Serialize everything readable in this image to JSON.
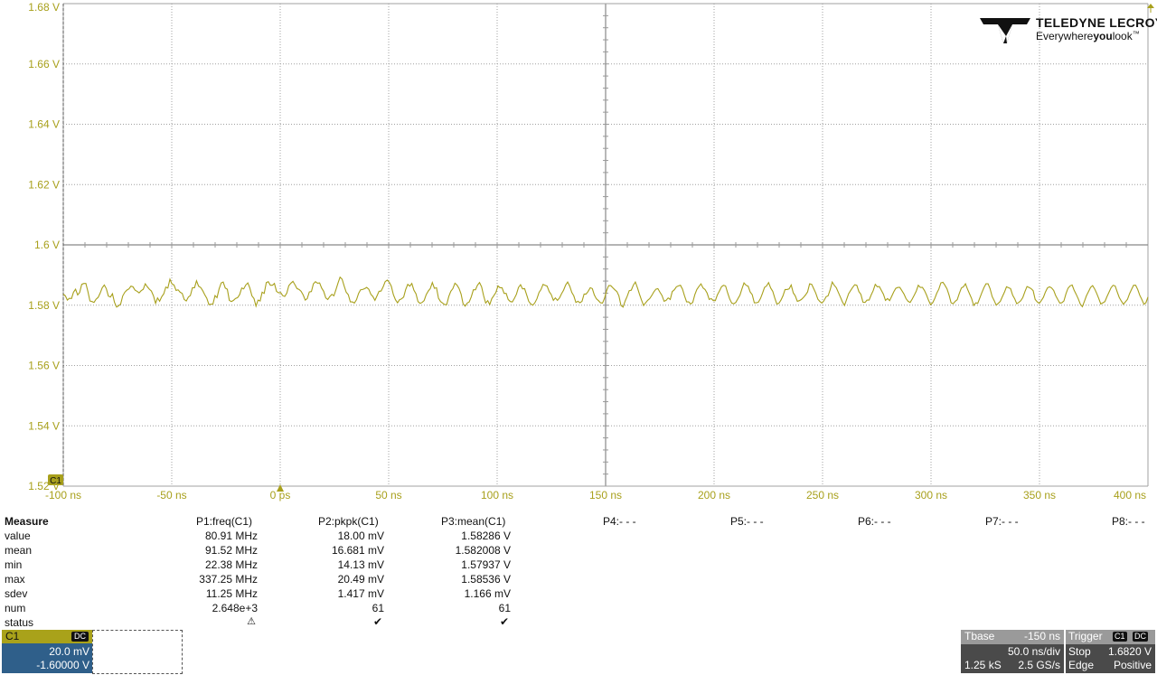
{
  "colors": {
    "channel": "#a8a01c",
    "grid": "#a0a0a0",
    "trace": "#a8a01c",
    "panel": "#4a4a4a",
    "channel_panel": "#2f5f8a"
  },
  "logo": {
    "brand": "TELEDYNE LECROY",
    "tag_pre": "Everywhere",
    "tag_bold": "you",
    "tag_post": "look",
    "trademark": "™"
  },
  "chart_data": {
    "type": "line",
    "y_tick_labels": [
      "1.68 V",
      "1.66 V",
      "1.64 V",
      "1.62 V",
      "1.6 V",
      "1.58 V",
      "1.56 V",
      "1.54 V",
      "1.52 V"
    ],
    "x_tick_labels": [
      "-100 ns",
      "-50 ns",
      "0 ps",
      "50 ns",
      "100 ns",
      "150 ns",
      "200 ns",
      "250 ns",
      "300 ns",
      "350 ns",
      "400 ns"
    ],
    "xlim_ns": [
      -100,
      400
    ],
    "ylim_V": [
      1.52,
      1.68
    ],
    "grid": true,
    "trigger_marker_ns": 0,
    "channel_marker": "C1",
    "series": [
      {
        "name": "C1",
        "approx_frequency_MHz": 80.91,
        "mean_V": 1.58286,
        "pkpk_mV": 18.0,
        "y": [
          1.5837,
          1.5831,
          1.5817,
          1.5823,
          1.5822,
          1.5843,
          1.5853,
          1.5834,
          1.5842,
          1.5869,
          1.5872,
          1.5872,
          1.5846,
          1.5814,
          1.5812,
          1.5809,
          1.582,
          1.5826,
          1.584,
          1.5858,
          1.5867,
          1.5855,
          1.583,
          1.5827,
          1.5838,
          1.5809,
          1.5794,
          1.5798,
          1.5804,
          1.5831,
          1.5843,
          1.585,
          1.5854,
          1.5863,
          1.5861,
          1.585,
          1.5846,
          1.5841,
          1.5848,
          1.5853,
          1.5871,
          1.5861,
          1.5853,
          1.5847,
          1.5831,
          1.5806,
          1.5824,
          1.5813,
          1.5828,
          1.5838,
          1.586,
          1.5857,
          1.5886,
          1.5871,
          1.5867,
          1.5849,
          1.5851,
          1.5843,
          1.5839,
          1.5819,
          1.5814,
          1.5827,
          1.5832,
          1.5858,
          1.5858,
          1.5881,
          1.5863,
          1.5859,
          1.5848,
          1.5835,
          1.5823,
          1.5802,
          1.5803,
          1.5804,
          1.5832,
          1.5825,
          1.5854,
          1.5874,
          1.5877,
          1.5857,
          1.5853,
          1.5816,
          1.5812,
          1.5816,
          1.5822,
          1.5825,
          1.5835,
          1.5857,
          1.5854,
          1.5867,
          1.5874,
          1.5857,
          1.5831,
          1.5822,
          1.5797,
          1.5817,
          1.5814,
          1.5843,
          1.5839,
          1.5875,
          1.5878,
          1.5866,
          1.5866,
          1.5872,
          1.5846,
          1.5841,
          1.5842,
          1.5832,
          1.5829,
          1.584,
          1.5865,
          1.5873,
          1.5879,
          1.5868,
          1.5855,
          1.5852,
          1.5846,
          1.5834,
          1.5817,
          1.5822,
          1.5844,
          1.5845,
          1.5871,
          1.5878,
          1.5873,
          1.5874,
          1.5857,
          1.5846,
          1.5824,
          1.5819,
          1.5829,
          1.5836,
          1.5831,
          1.5852,
          1.5874,
          1.5893,
          1.5886,
          1.5863,
          1.5843,
          1.5835,
          1.5811,
          1.5811,
          1.5807,
          1.5818,
          1.5839,
          1.5851,
          1.5852,
          1.5855,
          1.5859,
          1.5853,
          1.5836,
          1.5829,
          1.5816,
          1.5831,
          1.5846,
          1.5847,
          1.5861,
          1.5878,
          1.5883,
          1.5876,
          1.5863,
          1.5835,
          1.5818,
          1.5808,
          1.5818,
          1.5821,
          1.5827,
          1.5852,
          1.5869,
          1.5863,
          1.5872,
          1.585,
          1.5838,
          1.5812,
          1.5806,
          1.5809,
          1.5815,
          1.5835,
          1.5847,
          1.5855,
          1.5875,
          1.5856,
          1.5858,
          1.5823,
          1.5812,
          1.5807,
          1.5802,
          1.5802,
          1.5829,
          1.5846,
          1.5855,
          1.5873,
          1.5867,
          1.5856,
          1.5837,
          1.5805,
          1.5797,
          1.5807,
          1.5811,
          1.5828,
          1.5851,
          1.5851,
          1.5866,
          1.5875,
          1.5861,
          1.5832,
          1.5807,
          1.5815,
          1.5802,
          1.5822,
          1.5832,
          1.5842,
          1.5864,
          1.5858,
          1.5858,
          1.5839,
          1.5839,
          1.5819,
          1.5812,
          1.5811,
          1.5823,
          1.5836,
          1.5859,
          1.5868,
          1.5854,
          1.5855,
          1.5834,
          1.5813,
          1.5804,
          1.58,
          1.5808,
          1.5821,
          1.5842,
          1.5852,
          1.5869,
          1.5866,
          1.5863,
          1.5845,
          1.5835,
          1.5816,
          1.5824,
          1.5816,
          1.5824,
          1.5838,
          1.585,
          1.5867,
          1.5877,
          1.5863,
          1.5842,
          1.5831,
          1.5809,
          1.5813,
          1.5808,
          1.5813,
          1.5837,
          1.5837,
          1.5846,
          1.5858,
          1.5855,
          1.5834,
          1.5821,
          1.5815,
          1.5808,
          1.5807,
          1.5824,
          1.5848,
          1.5865,
          1.5865,
          1.5858,
          1.5851,
          1.5845,
          1.5831,
          1.5799,
          1.5794,
          1.5814,
          1.5829,
          1.5848,
          1.585,
          1.5866,
          1.5877,
          1.5858,
          1.5837,
          1.5817,
          1.5799,
          1.5808,
          1.5816,
          1.5822,
          1.5832,
          1.5844,
          1.5853,
          1.5855,
          1.5843,
          1.5832,
          1.5813,
          1.5816,
          1.5824,
          1.5819,
          1.5845,
          1.5851,
          1.5861,
          1.5864,
          1.5866,
          1.5853,
          1.5831,
          1.5811,
          1.5811,
          1.5804,
          1.5809,
          1.5835,
          1.5852,
          1.5862,
          1.5871,
          1.5857,
          1.5852,
          1.584,
          1.5819,
          1.5822,
          1.5815,
          1.5815,
          1.5834,
          1.5847,
          1.5861,
          1.5866,
          1.5864,
          1.5841,
          1.5821,
          1.5807,
          1.5805,
          1.5809,
          1.5821,
          1.5833,
          1.5855,
          1.5874,
          1.5866,
          1.5863,
          1.5844,
          1.5835,
          1.5808,
          1.5808,
          1.581,
          1.5822,
          1.5839,
          1.5859,
          1.5864,
          1.5875,
          1.5857,
          1.5846,
          1.5824,
          1.5804,
          1.5806,
          1.5817,
          1.5831,
          1.5852,
          1.5852,
          1.5854,
          1.5867,
          1.5841,
          1.5831,
          1.5813,
          1.5815,
          1.5819,
          1.5826,
          1.5834,
          1.5844,
          1.5871,
          1.5869,
          1.5855,
          1.584,
          1.582,
          1.5812,
          1.5807,
          1.5815,
          1.5828,
          1.5831,
          1.5851,
          1.5877,
          1.5866,
          1.5858,
          1.5842,
          1.5827,
          1.5811,
          1.5799,
          1.5818,
          1.5838,
          1.5849,
          1.5859,
          1.5868,
          1.5866,
          1.5845,
          1.5836,
          1.581,
          1.5809,
          1.5817,
          1.5817,
          1.5834,
          1.5848,
          1.5869,
          1.5861,
          1.5862,
          1.5849,
          1.5836,
          1.5816,
          1.5822,
          1.5815,
          1.5829,
          1.5844,
          1.5856,
          1.5859,
          1.5859,
          1.5848,
          1.5837,
          1.5822,
          1.5813,
          1.5809,
          1.582,
          1.5833,
          1.5847,
          1.5866,
          1.5859,
          1.5859,
          1.5849,
          1.5834,
          1.5816,
          1.5802,
          1.5808,
          1.5822,
          1.584,
          1.5853,
          1.5874,
          1.5876,
          1.5866,
          1.5854,
          1.5833,
          1.5808,
          1.5805,
          1.5813,
          1.5818,
          1.5839,
          1.5857,
          1.5861,
          1.5871,
          1.5853,
          1.5838,
          1.5822,
          1.5799,
          1.5808,
          1.5806,
          1.5824,
          1.5842,
          1.5858,
          1.5871,
          1.5871,
          1.5855,
          1.5829,
          1.5815,
          1.58,
          1.5806,
          1.5813,
          1.5828,
          1.5843,
          1.5861,
          1.5858,
          1.5855,
          1.5833,
          1.5821,
          1.5805,
          1.5809,
          1.5815,
          1.5826,
          1.5845,
          1.5862,
          1.5859,
          1.5855,
          1.5848,
          1.5819,
          1.5811,
          1.5806,
          1.5815,
          1.5826,
          1.5844,
          1.5857,
          1.5861,
          1.5857,
          1.5849,
          1.5832,
          1.5819,
          1.5807,
          1.5808,
          1.5814,
          1.5838,
          1.5856,
          1.5864,
          1.5867,
          1.585,
          1.5836,
          1.5821,
          1.5804,
          1.5795,
          1.5813,
          1.5831,
          1.5845,
          1.5859,
          1.5865,
          1.5854,
          1.5839,
          1.5822,
          1.5804,
          1.5808,
          1.5812,
          1.5828,
          1.5843,
          1.5858,
          1.5866,
          1.5864,
          1.5844,
          1.5826,
          1.5814,
          1.5803,
          1.5811,
          1.5819,
          1.5838,
          1.5853,
          1.5866,
          1.5866,
          1.5852,
          1.5833,
          1.5819,
          1.5803,
          1.5808,
          1.5827
        ]
      }
    ]
  },
  "measure": {
    "title": "Measure",
    "params": [
      "P1:freq(C1)",
      "P2:pkpk(C1)",
      "P3:mean(C1)",
      "P4:- - -",
      "P5:- - -",
      "P6:- - -",
      "P7:- - -",
      "P8:- - -"
    ],
    "row_labels": [
      "value",
      "mean",
      "min",
      "max",
      "sdev",
      "num",
      "status"
    ],
    "columns": [
      [
        "80.91 MHz",
        "91.52 MHz",
        "22.38 MHz",
        "337.25 MHz",
        "11.25 MHz",
        "2.648e+3"
      ],
      [
        "18.00 mV",
        "16.681 mV",
        "14.13 mV",
        "20.49 mV",
        "1.417 mV",
        "61"
      ],
      [
        "1.58286 V",
        "1.582008 V",
        "1.57937 V",
        "1.58536 V",
        "1.166 mV",
        "61"
      ]
    ],
    "status": [
      "⚠",
      "✔",
      "✔"
    ]
  },
  "channel": {
    "label": "C1",
    "coupling": "DC",
    "scale": "20.0 mV",
    "offset": "-1.60000 V"
  },
  "timebase": {
    "label": "Tbase",
    "delay": "-150 ns",
    "per_div": "50.0 ns/div",
    "samples": "1.25 kS",
    "rate": "2.5 GS/s"
  },
  "trigger": {
    "label": "Trigger",
    "source": "C1",
    "coupling": "DC",
    "mode": "Stop",
    "level": "1.6820 V",
    "type": "Edge",
    "slope": "Positive"
  }
}
